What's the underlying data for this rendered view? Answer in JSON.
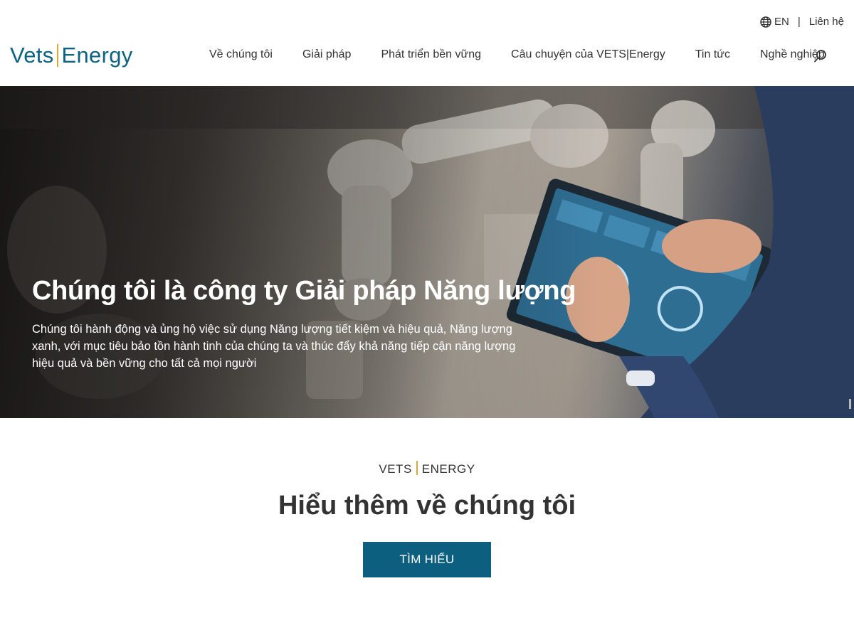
{
  "utility": {
    "language": "EN",
    "contact": "Liên hệ",
    "globe_icon": "globe-icon"
  },
  "header": {
    "logo_left": "Vets",
    "logo_right": "Energy",
    "nav": [
      {
        "label": "Về chúng tôi"
      },
      {
        "label": "Giải pháp"
      },
      {
        "label": "Phát triển bền vững"
      },
      {
        "label": "Câu chuyện của VETS|Energy"
      },
      {
        "label": "Tin tức"
      },
      {
        "label": "Nghề nghiệp"
      }
    ],
    "search_icon": "search-icon"
  },
  "hero": {
    "title": "Chúng tôi là công ty Giải pháp Năng lượng",
    "description": "Chúng tôi hành động và ủng hộ việc sử dụng Năng lượng tiết kiệm và hiệu quả, Năng lượng xanh, với mục tiêu bảo tồn hành tinh của chúng ta và thúc đẩy khả năng tiếp cận năng lượng hiệu quả và bền vững cho tất cả mọi người"
  },
  "about": {
    "brand_left": "VETS",
    "brand_right": "ENERGY",
    "title": "Hiểu thêm về chúng tôi",
    "cta_label": "TÌM HIỂU"
  },
  "colors": {
    "brand": "#0d6382",
    "accent": "#e3a72f",
    "button": "#0d5f80"
  }
}
